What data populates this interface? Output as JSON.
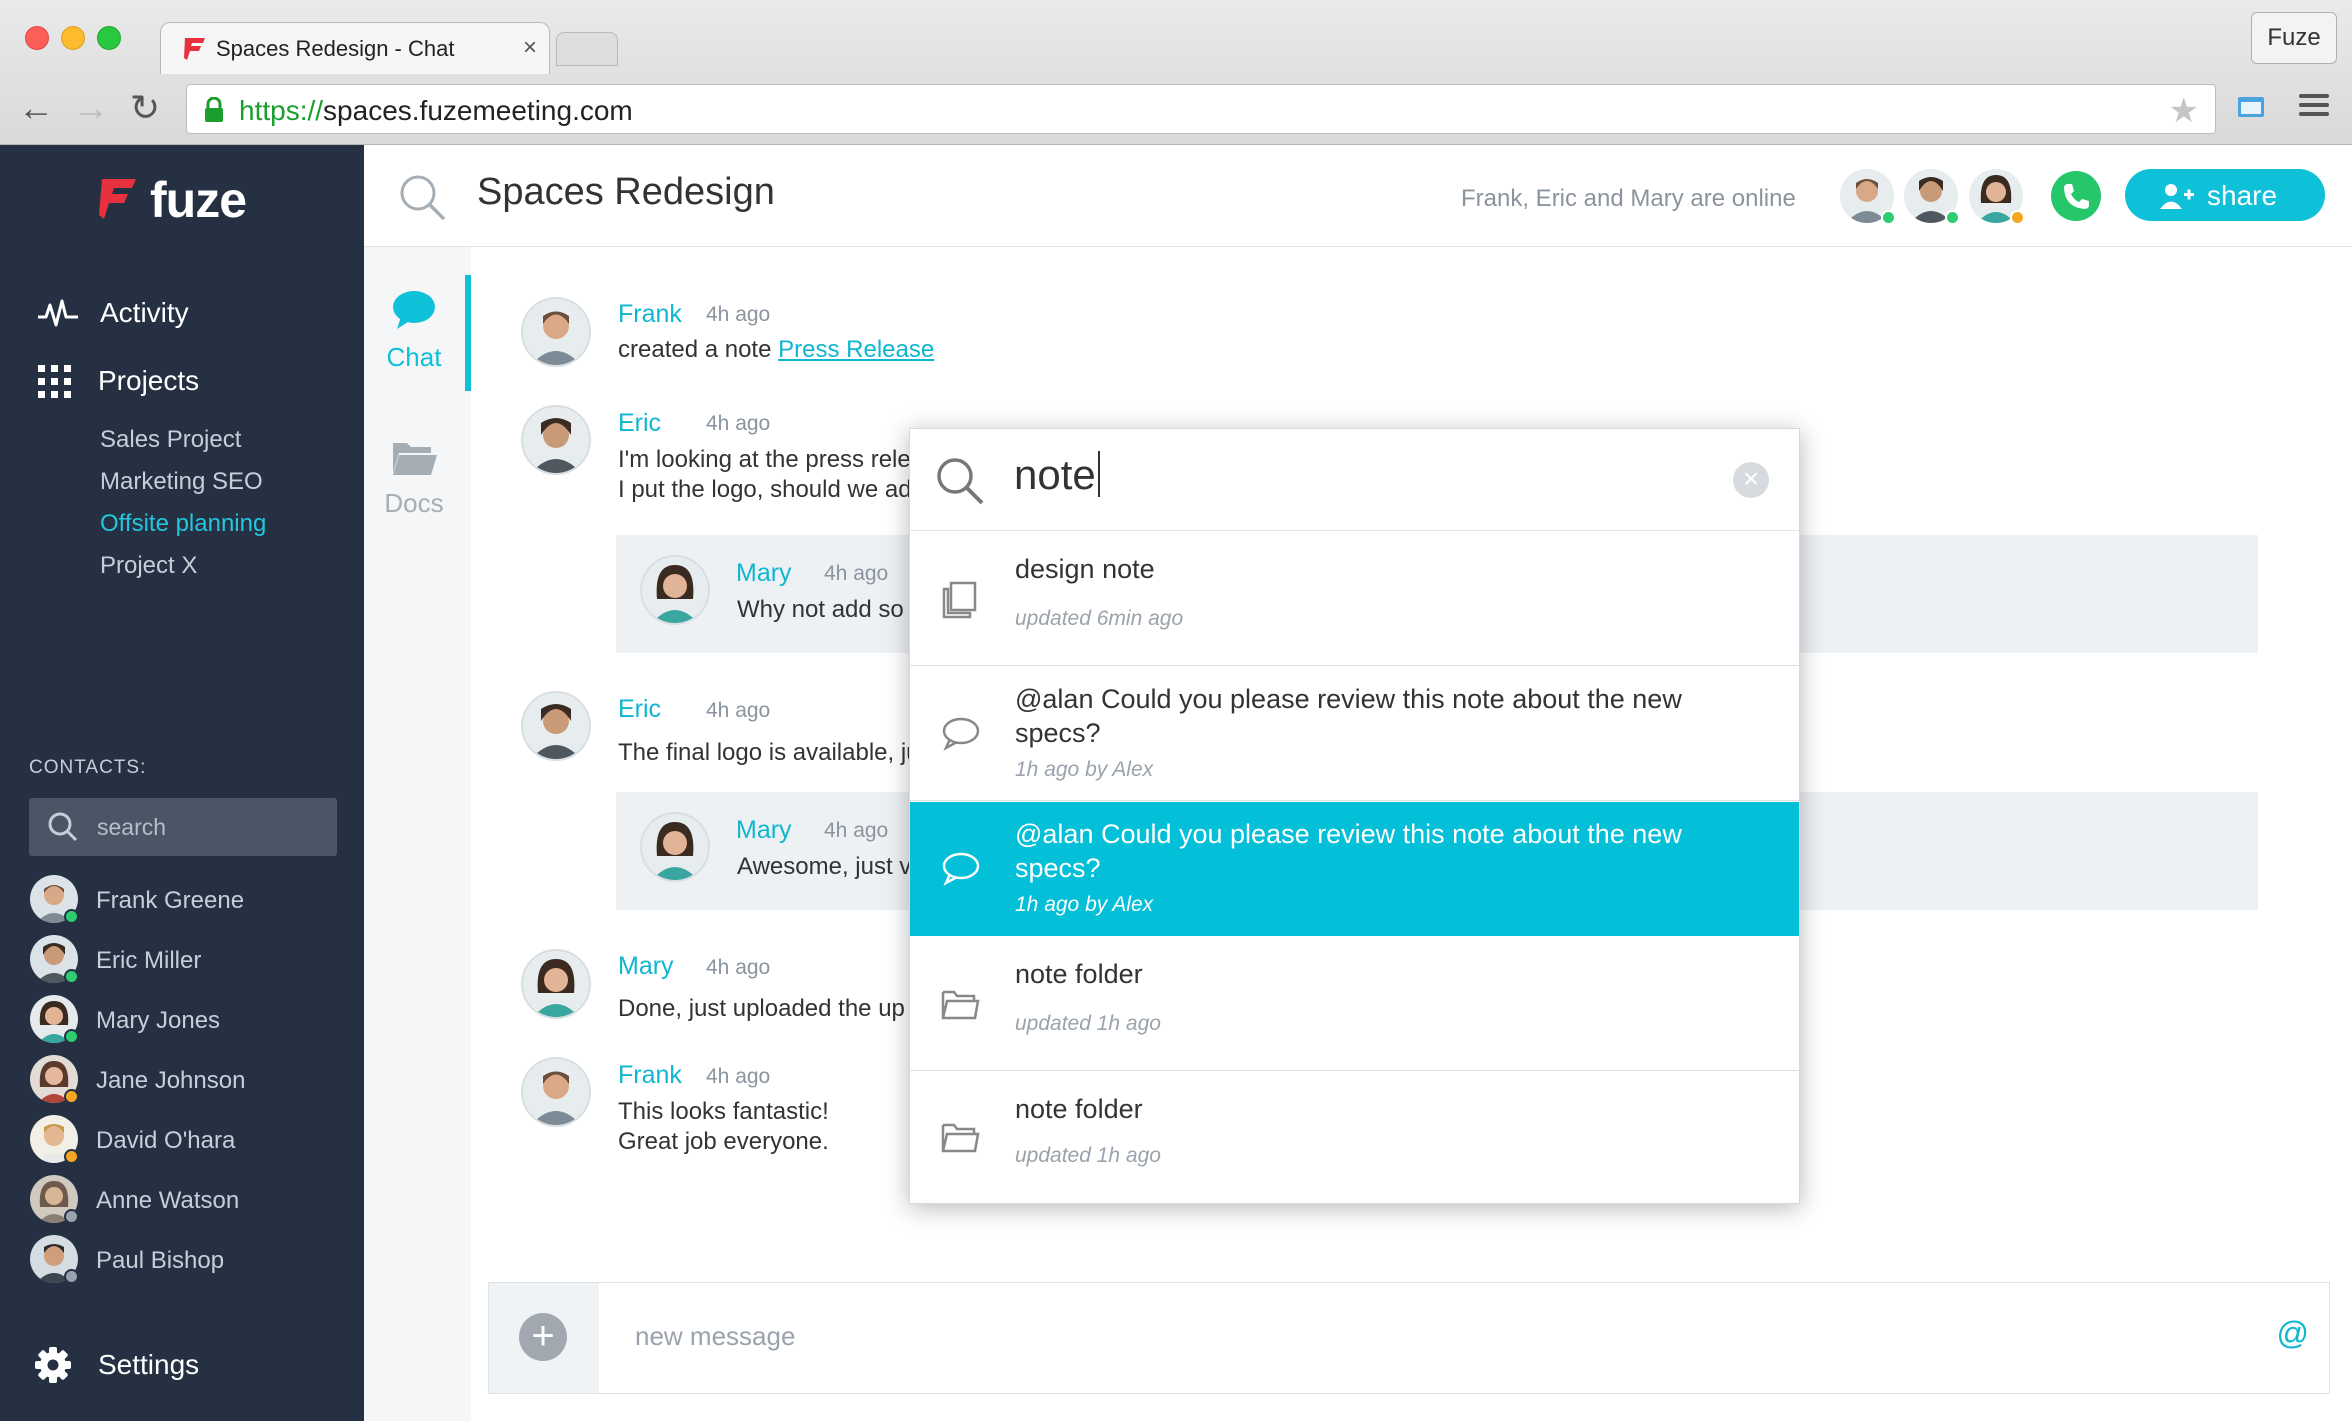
{
  "browser": {
    "tab_title": "Spaces Redesign - Chat",
    "tab_close": "×",
    "profile": "Fuze",
    "url_protocol": "https://",
    "url_host": "spaces.fuzemeeting.com"
  },
  "sidebar": {
    "brand": "fuze",
    "nav": [
      {
        "label": "Activity"
      },
      {
        "label": "Projects"
      }
    ],
    "projects": [
      {
        "label": "Sales Project"
      },
      {
        "label": "Marketing SEO"
      },
      {
        "label": "Offsite planning",
        "active": true
      },
      {
        "label": "Project X"
      }
    ],
    "contacts_heading": "CONTACTS:",
    "search_placeholder": "search",
    "contacts": [
      {
        "name": "Frank Greene",
        "status": "#2ecc71"
      },
      {
        "name": "Eric Miller",
        "status": "#2ecc71"
      },
      {
        "name": "Mary Jones",
        "status": "#2ecc71"
      },
      {
        "name": "Jane Johnson",
        "status": "#f5a623"
      },
      {
        "name": "David O'hara",
        "status": "#f5a623"
      },
      {
        "name": "Anne Watson",
        "status": "#9aa2ab"
      },
      {
        "name": "Paul Bishop",
        "status": "#9aa2ab"
      }
    ],
    "settings": "Settings"
  },
  "header": {
    "title": "Spaces Redesign",
    "online_text": "Frank, Eric and Mary are online",
    "share": "share"
  },
  "channels": {
    "chat": "Chat",
    "docs": "Docs"
  },
  "feed": {
    "messages": [
      {
        "name": "Frank",
        "time": "4h ago",
        "text": "created a note ",
        "link": "Press Release"
      },
      {
        "name": "Eric",
        "time": "4h ago",
        "line1": "I'm looking at the press rele",
        "line2": "I put the logo, should we ad"
      },
      {
        "name": "Mary",
        "time": "4h ago",
        "text": "Why not add so"
      },
      {
        "name": "Eric",
        "time": "4h ago",
        "text": "The final logo is available, ju"
      },
      {
        "name": "Mary",
        "time": "4h ago",
        "text": "Awesome, just v"
      },
      {
        "name": "Mary",
        "time": "4h ago",
        "text": "Done, just uploaded the up"
      },
      {
        "name": "Frank",
        "time": "4h ago",
        "line1": "This looks fantastic!",
        "line2": "Great job everyone."
      }
    ]
  },
  "composer": {
    "placeholder": "new message",
    "at": "@"
  },
  "search_popup": {
    "query": "note",
    "clear": "×",
    "results": [
      {
        "title": "design note",
        "meta": "updated 6min ago",
        "icon": "note-icon"
      },
      {
        "title": "@alan Could you please review this note about the new specs?",
        "meta": "1h ago by Alex",
        "icon": "chat-bubble-icon"
      },
      {
        "title": "@alan Could you please review this note about the new specs?",
        "meta": "1h ago by Alex",
        "icon": "chat-bubble-icon",
        "selected": true
      },
      {
        "title": "note folder",
        "meta": "updated 1h ago",
        "icon": "folder-icon"
      },
      {
        "title": "note folder",
        "meta": "updated 1h ago",
        "icon": "folder-icon"
      }
    ]
  },
  "colors": {
    "accent": "#0fc0d9",
    "sidebar_bg": "#253142",
    "call_green": "#26c66a",
    "brand_red": "#e8313e"
  }
}
